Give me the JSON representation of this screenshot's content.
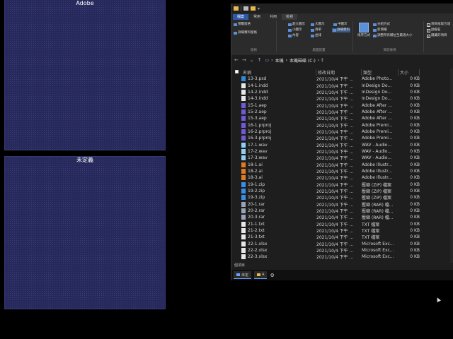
{
  "panels": {
    "top_title": "Adobe",
    "bottom_title": "未定義"
  },
  "explorer": {
    "ribbon_tabs": [
      "檔案",
      "常用",
      "共用",
      "檢視"
    ],
    "ribbon": {
      "preview_pane": "預覽窗格",
      "details_pane": "詳細資料窗格",
      "extra_large": "超大圖示",
      "large": "大圖示",
      "medium": "中圖示",
      "small": "小圖示",
      "list": "清單",
      "details": "詳細資料",
      "tiles": "並排",
      "content": "內容",
      "layout_group": "版面配置",
      "sort_by": "排序方式",
      "group_by": "分組方式",
      "add_columns": "新增欄",
      "size_columns": "調整所有欄位至最適大小",
      "current_view_group": "目前檢視",
      "item_checkboxes": "項目核取方塊",
      "file_extensions": "副檔名",
      "hidden_items": "隱藏的項目",
      "pane_group": "窗格"
    },
    "path": [
      "本機",
      "本機磁碟 (C:)",
      "t"
    ],
    "columns": {
      "name": "名稱",
      "date": "修改日期",
      "type": "類型",
      "size": "大小"
    },
    "files": [
      {
        "name": "13-3.psd",
        "date": "2021/10/4 下午 ...",
        "type": "Adobe Photo...",
        "size": "0 KB",
        "color": "#2e8bd8"
      },
      {
        "name": "14-1.indd",
        "date": "2021/10/4 下午 ...",
        "type": "InDesign Do...",
        "size": "0 KB",
        "color": "#e8e8e8"
      },
      {
        "name": "14-2.indd",
        "date": "2021/10/4 下午 ...",
        "type": "InDesign Do...",
        "size": "0 KB",
        "color": "#e8e8e8"
      },
      {
        "name": "14-3.indd",
        "date": "2021/10/4 下午 ...",
        "type": "InDesign Do...",
        "size": "0 KB",
        "color": "#e8e8e8"
      },
      {
        "name": "15-1.aep",
        "date": "2021/10/4 下午 ...",
        "type": "Adobe After ...",
        "size": "0 KB",
        "color": "#6f5bd6"
      },
      {
        "name": "15-2.aep",
        "date": "2021/10/4 下午 ...",
        "type": "Adobe After ...",
        "size": "0 KB",
        "color": "#6f5bd6"
      },
      {
        "name": "15-3.aep",
        "date": "2021/10/4 下午 ...",
        "type": "Adobe After ...",
        "size": "0 KB",
        "color": "#6f5bd6"
      },
      {
        "name": "16-1.prproj",
        "date": "2021/10/4 下午 ...",
        "type": "Adobe Premi...",
        "size": "0 KB",
        "color": "#6f5bd6"
      },
      {
        "name": "16-2.prproj",
        "date": "2021/10/4 下午 ...",
        "type": "Adobe Premi...",
        "size": "0 KB",
        "color": "#6f5bd6"
      },
      {
        "name": "16-3.prproj",
        "date": "2021/10/4 下午 ...",
        "type": "Adobe Premi...",
        "size": "0 KB",
        "color": "#6f5bd6"
      },
      {
        "name": "17-1.wav",
        "date": "2021/10/4 下午 ...",
        "type": "WAV - Audio...",
        "size": "0 KB",
        "color": "#8fd0f0"
      },
      {
        "name": "17-2.wav",
        "date": "2021/10/4 下午 ...",
        "type": "WAV - Audio...",
        "size": "0 KB",
        "color": "#8fd0f0"
      },
      {
        "name": "17-3.wav",
        "date": "2021/10/4 下午 ...",
        "type": "WAV - Audio...",
        "size": "0 KB",
        "color": "#8fd0f0"
      },
      {
        "name": "18-1.ai",
        "date": "2021/10/4 下午 ...",
        "type": "Adobe Illustr...",
        "size": "0 KB",
        "color": "#e07b20"
      },
      {
        "name": "18-2.ai",
        "date": "2021/10/4 下午 ...",
        "type": "Adobe Illustr...",
        "size": "0 KB",
        "color": "#e07b20"
      },
      {
        "name": "18-3.ai",
        "date": "2021/10/4 下午 ...",
        "type": "Adobe Illustr...",
        "size": "0 KB",
        "color": "#e07b20"
      },
      {
        "name": "19-1.zip",
        "date": "2021/10/4 下午 ...",
        "type": "壓縮 (ZIP) 檔案",
        "size": "0 KB",
        "color": "#3a8ee6"
      },
      {
        "name": "19-2.zip",
        "date": "2021/10/4 下午 ...",
        "type": "壓縮 (ZIP) 檔案",
        "size": "0 KB",
        "color": "#3a8ee6"
      },
      {
        "name": "19-3.zip",
        "date": "2021/10/4 下午 ...",
        "type": "壓縮 (ZIP) 檔案",
        "size": "0 KB",
        "color": "#3a8ee6"
      },
      {
        "name": "20-1.rar",
        "date": "2021/10/4 下午 ...",
        "type": "壓縮 (RAR) 檔...",
        "size": "0 KB",
        "color": "#9aa4b8"
      },
      {
        "name": "20-2.rar",
        "date": "2021/10/4 下午 ...",
        "type": "壓縮 (RAR) 檔...",
        "size": "0 KB",
        "color": "#9aa4b8"
      },
      {
        "name": "20-3.rar",
        "date": "2021/10/4 下午 ...",
        "type": "壓縮 (RAR) 檔...",
        "size": "0 KB",
        "color": "#9aa4b8"
      },
      {
        "name": "21-1.txt",
        "date": "2021/10/4 下午 ...",
        "type": "TXT 檔案",
        "size": "0 KB",
        "color": "#e8e8e8"
      },
      {
        "name": "21-2.txt",
        "date": "2021/10/4 下午 ...",
        "type": "TXT 檔案",
        "size": "0 KB",
        "color": "#e8e8e8"
      },
      {
        "name": "21-3.txt",
        "date": "2021/10/4 下午 ...",
        "type": "TXT 檔案",
        "size": "0 KB",
        "color": "#e8e8e8"
      },
      {
        "name": "22-1.xlsx",
        "date": "2021/10/4 下午 ...",
        "type": "Microsoft Exc...",
        "size": "0 KB",
        "color": "#e8e8e8"
      },
      {
        "name": "22-2.xlsx",
        "date": "2021/10/4 下午 ...",
        "type": "Microsoft Exc...",
        "size": "0 KB",
        "color": "#e8e8e8"
      },
      {
        "name": "22-3.xlsx",
        "date": "2021/10/4 下午 ...",
        "type": "Microsoft Exc...",
        "size": "0 KB",
        "color": "#e8e8e8"
      }
    ],
    "status": "個項目",
    "taskbar": [
      {
        "label": "未定"
      },
      {
        "label": "A"
      }
    ]
  }
}
